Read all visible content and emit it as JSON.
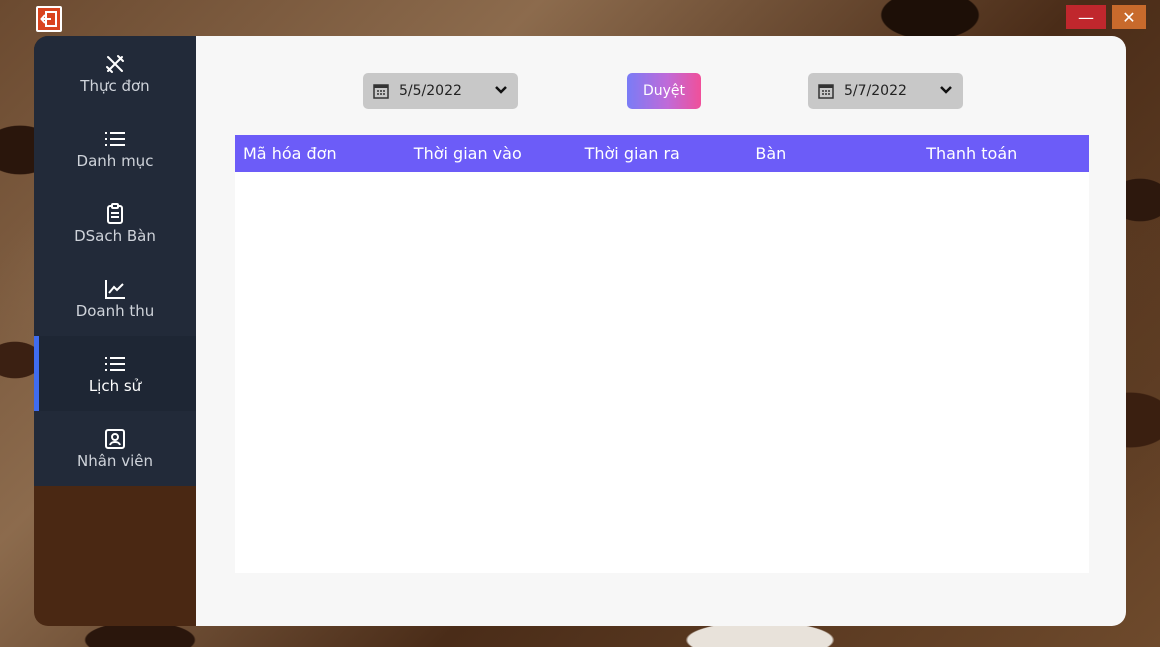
{
  "window": {
    "app_icon": "exit-icon",
    "minimize_icon": "minimize-icon",
    "close_icon": "close-icon",
    "minimize_glyph": "—",
    "close_glyph": "✕"
  },
  "sidebar": {
    "items": [
      {
        "label": "Thực đơn",
        "icon": "utensils-crossed-icon"
      },
      {
        "label": "Danh mục",
        "icon": "list-icon"
      },
      {
        "label": "DSach Bàn",
        "icon": "clipboard-icon"
      },
      {
        "label": "Doanh thu",
        "icon": "chart-line-icon"
      },
      {
        "label": "Lịch sử",
        "icon": "list-icon",
        "active": true
      },
      {
        "label": "Nhân viên",
        "icon": "employee-card-icon"
      }
    ],
    "active_accent": "#3f6cf0"
  },
  "filters": {
    "date_from": "5/5/2022",
    "date_to": "5/7/2022",
    "browse_label": "Duyệt"
  },
  "table": {
    "columns": [
      "Mã hóa đơn",
      "Thời gian vào",
      "Thời gian ra",
      "Bàn",
      "Thanh toán"
    ],
    "rows": [],
    "header_color": "#6c5cf8"
  }
}
